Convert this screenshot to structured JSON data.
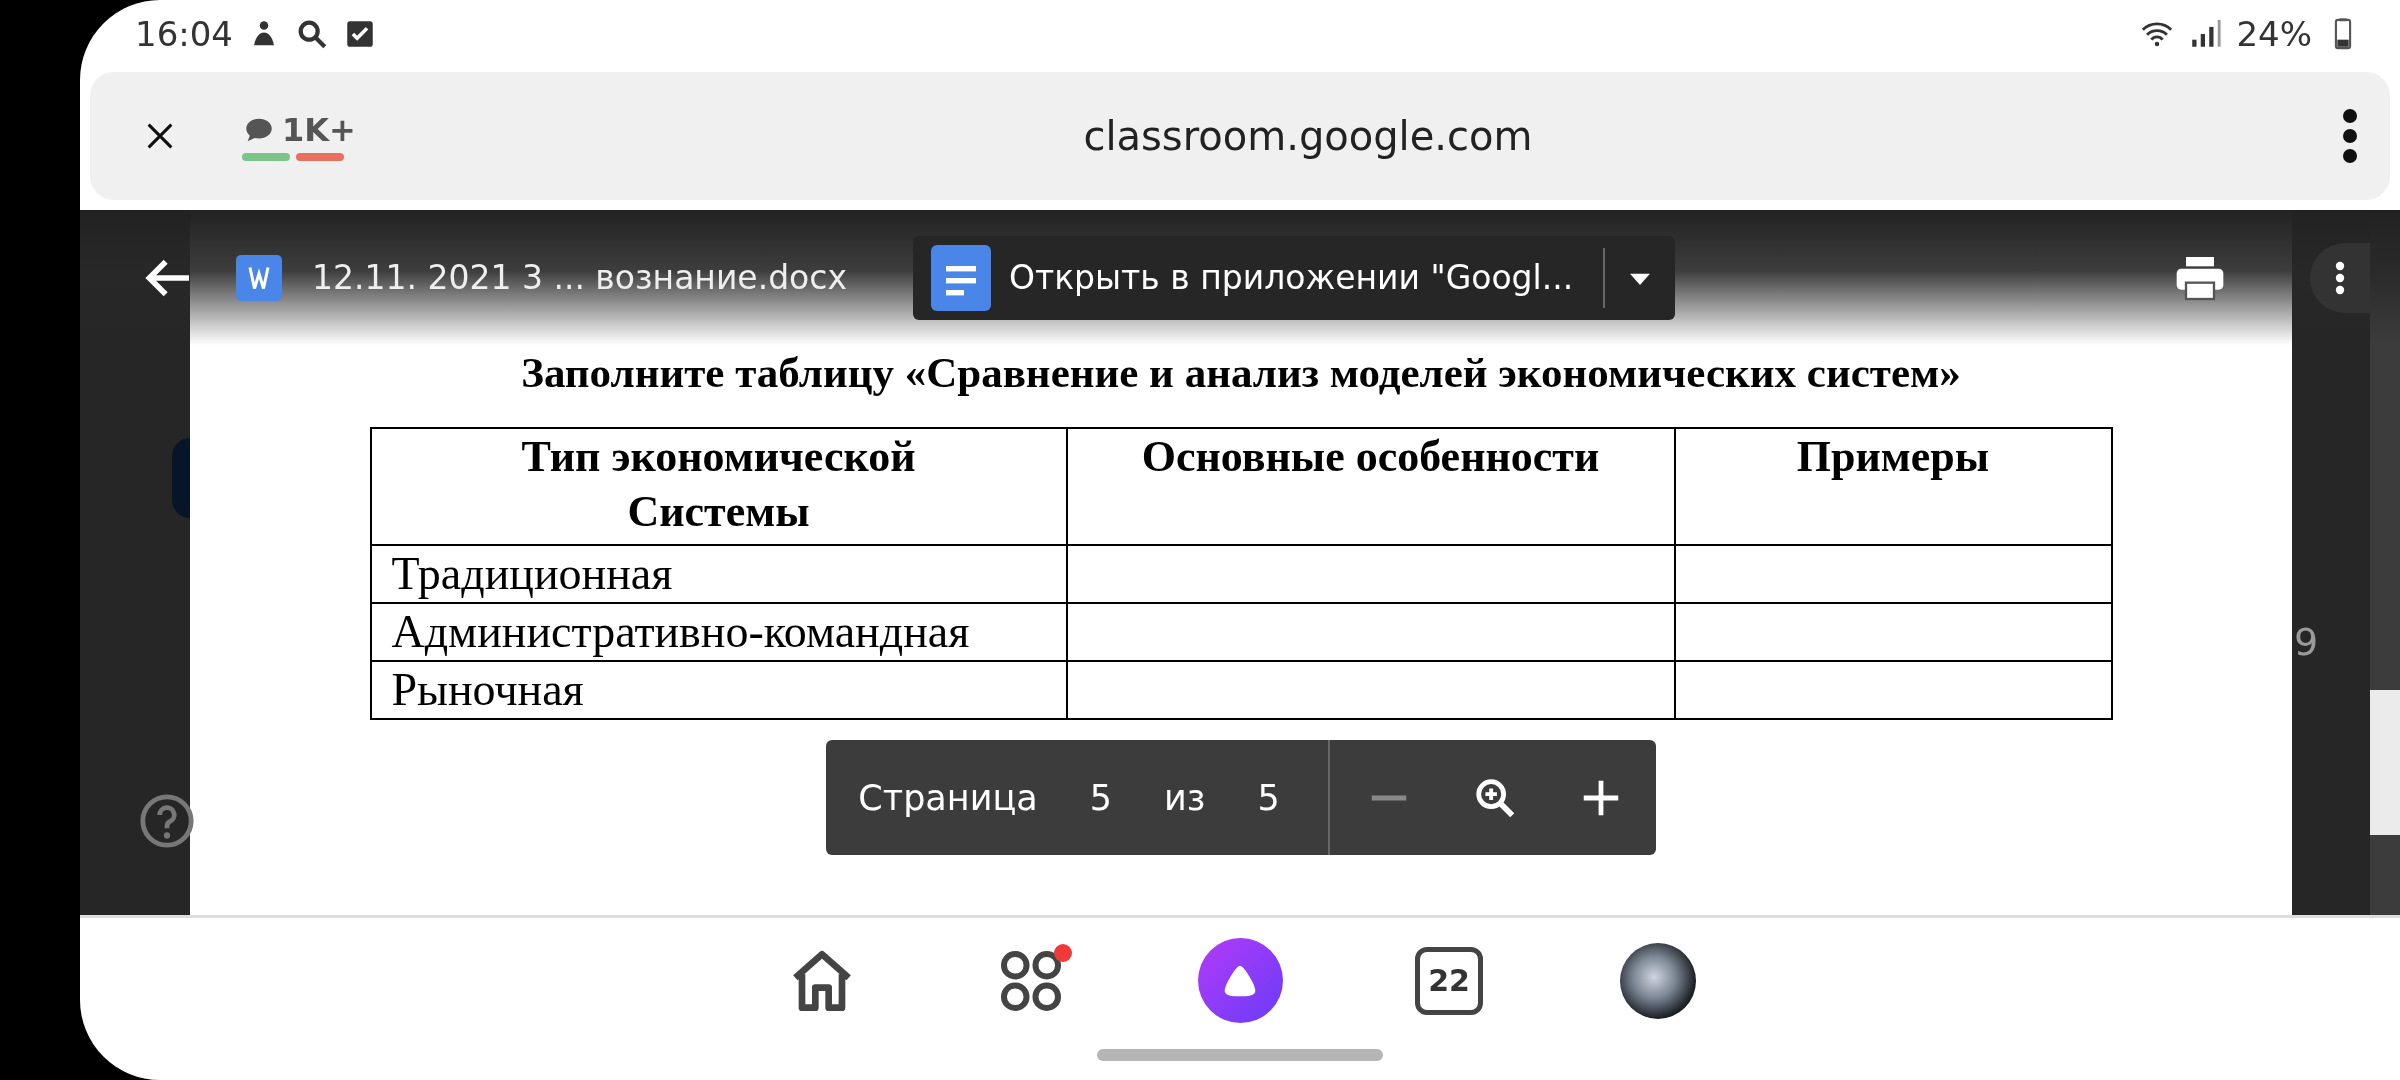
{
  "status_bar": {
    "time": "16:04",
    "battery": "24%"
  },
  "browser": {
    "comments": "1K+",
    "url": "classroom.google.com"
  },
  "viewer": {
    "file_name": "12.11. 2021 3 ... вознание.docx",
    "open_button": "Открыть в приложении \"Googl...",
    "background_fragment": "9"
  },
  "document": {
    "title": "Заполните таблицу «Сравнение и анализ моделей экономических систем»",
    "table": {
      "columns": [
        "Тип экономической\nСистемы",
        "Основные особенности",
        "Примеры"
      ],
      "rows": [
        {
          "cells": [
            "Традиционная"
          ]
        },
        {
          "cells": [
            "Административно-командная"
          ]
        },
        {
          "cells": [
            "Рыночная"
          ]
        }
      ]
    }
  },
  "page_nav": {
    "label": "Страница",
    "current": "5",
    "of": "из",
    "total": "5"
  },
  "bottom_nav": {
    "items": [
      {
        "kind": "home"
      },
      {
        "kind": "apps",
        "notification": true
      },
      {
        "kind": "assistant"
      },
      {
        "kind": "tabs",
        "label": "22"
      },
      {
        "kind": "profile"
      }
    ]
  }
}
